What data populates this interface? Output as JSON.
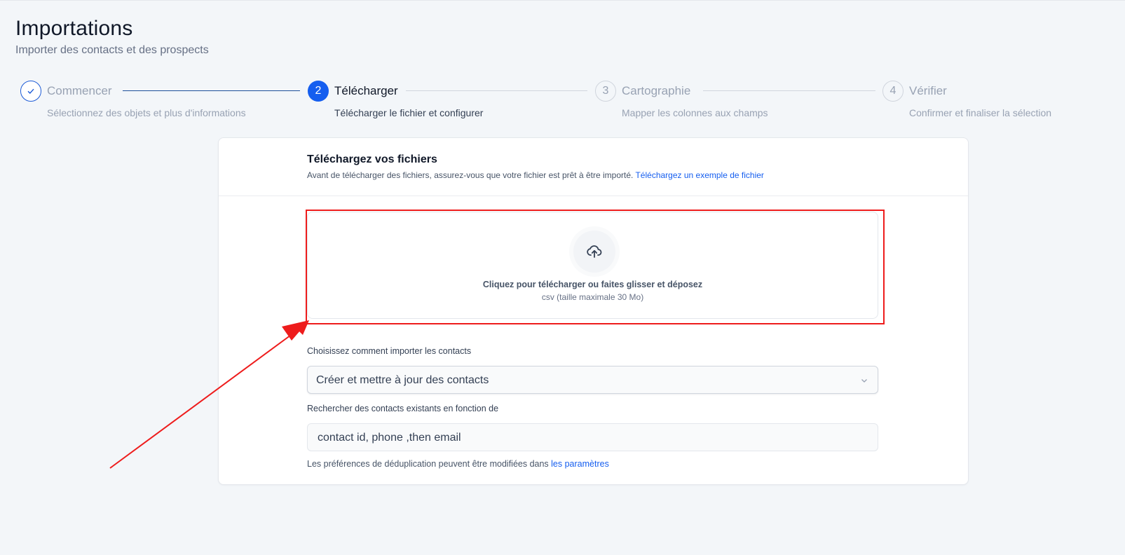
{
  "header": {
    "title": "Importations",
    "subtitle": "Importer des contacts et des prospects"
  },
  "stepper": {
    "steps": [
      {
        "number": "✓",
        "label": "Commencer",
        "description": "Sélectionnez des objets et plus d'informations",
        "state": "done"
      },
      {
        "number": "2",
        "label": "Télécharger",
        "description": "Télécharger le fichier et configurer",
        "state": "active"
      },
      {
        "number": "3",
        "label": "Cartographie",
        "description": "Mapper les colonnes aux champs",
        "state": "todo"
      },
      {
        "number": "4",
        "label": "Vérifier",
        "description": "Confirmer et finaliser la sélection",
        "state": "todo"
      }
    ]
  },
  "upload": {
    "title": "Téléchargez vos fichiers",
    "subtitle": "Avant de télécharger des fichiers, assurez-vous que votre fichier est prêt à être importé.",
    "sample_link": "Téléchargez un exemple de fichier",
    "dropzone_text": "Cliquez pour télécharger ou faites glisser et déposez",
    "dropzone_hint": "csv (taille maximale 30 Mo)",
    "icon": "cloud-upload-icon"
  },
  "import_mode": {
    "label": "Choisissez comment importer les contacts",
    "selected": "Créer et mettre à jour des contacts"
  },
  "dedupe": {
    "label": "Rechercher des contacts existants en fonction de",
    "value": "contact id, phone ,then email",
    "note": "Les préférences de déduplication peuvent être modifiées dans",
    "note_link": "les paramètres"
  },
  "colors": {
    "accent": "#155eef",
    "annotation": "#ee1c1c",
    "background": "#f3f6f9"
  }
}
